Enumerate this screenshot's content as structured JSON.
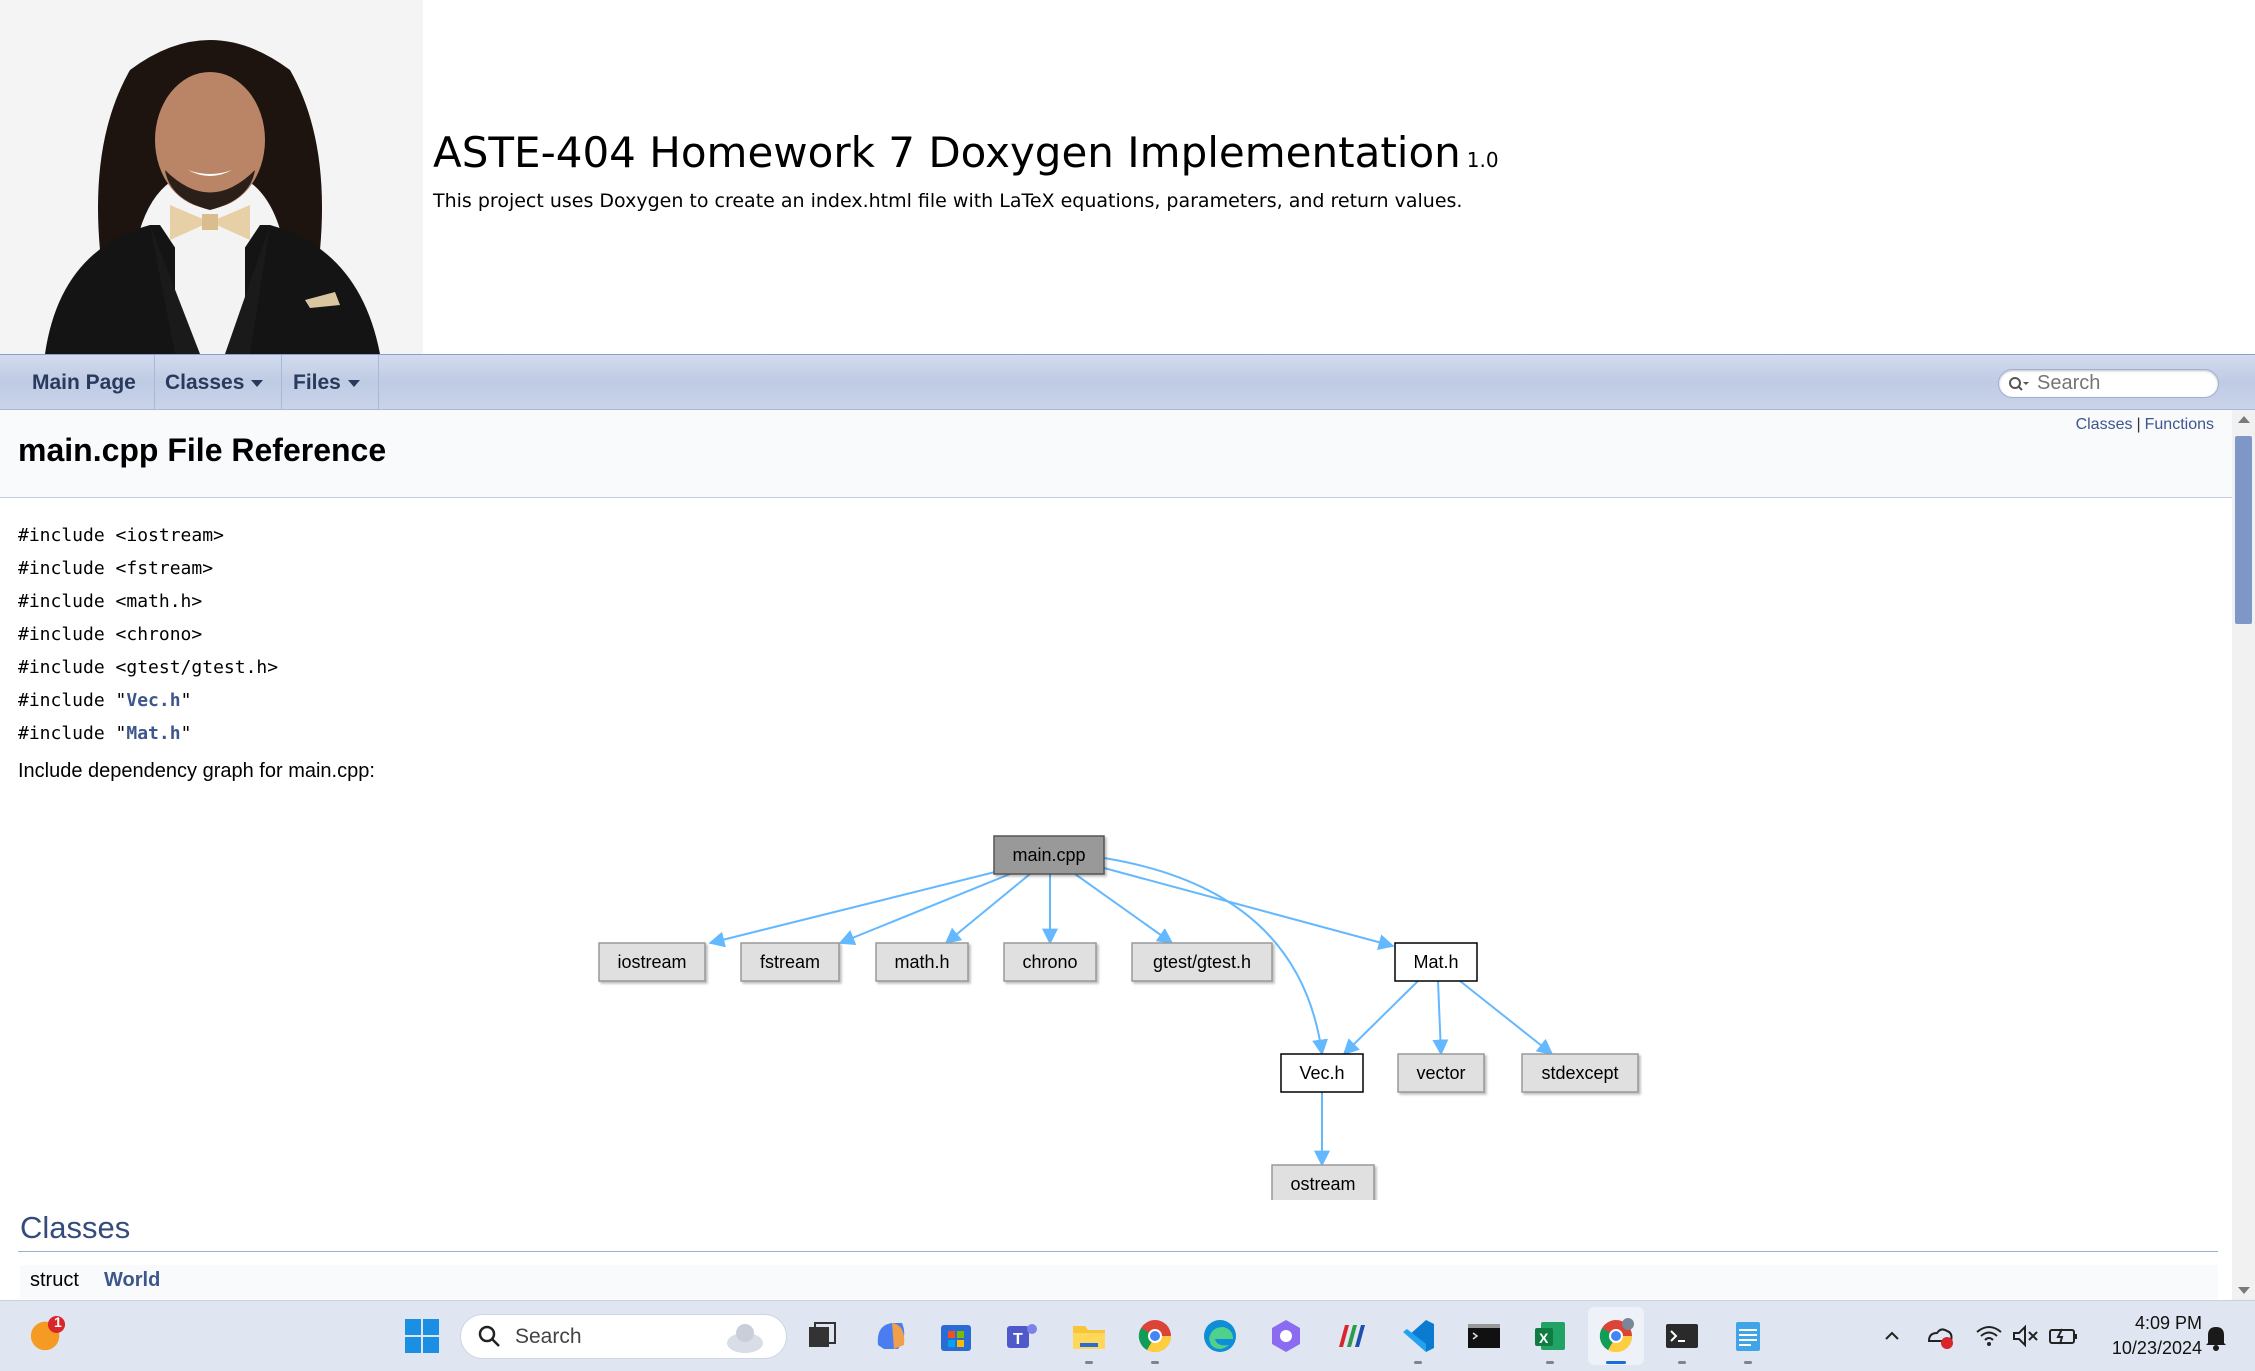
{
  "header": {
    "project_name": "ASTE-404 Homework 7 Doxygen Implementation",
    "project_number": "1.0",
    "project_brief": "This project uses Doxygen to create an index.html file with LaTeX equations, parameters, and return values."
  },
  "nav": {
    "main_page": "Main Page",
    "classes": "Classes",
    "files": "Files",
    "search_placeholder": "Search"
  },
  "page": {
    "summary_classes": "Classes",
    "summary_separator": "|",
    "summary_functions": "Functions",
    "title": "main.cpp File Reference",
    "includes": [
      {
        "prefix": "#include <iostream>"
      },
      {
        "prefix": "#include <fstream>"
      },
      {
        "prefix": "#include <math.h>"
      },
      {
        "prefix": "#include <chrono>"
      },
      {
        "prefix": "#include <gtest/gtest.h>"
      },
      {
        "prefix": "#include \"",
        "link": "Vec.h",
        "suffix": "\""
      },
      {
        "prefix": "#include \"",
        "link": "Mat.h",
        "suffix": "\""
      }
    ],
    "graph_caption": "Include dependency graph for main.cpp:",
    "graph_nodes": [
      "main.cpp",
      "iostream",
      "fstream",
      "math.h",
      "chrono",
      "gtest/gtest.h",
      "Mat.h",
      "Vec.h",
      "vector",
      "stdexcept",
      "ostream"
    ],
    "classes_heading": "Classes",
    "class_kind": "struct",
    "class_name": "World"
  },
  "taskbar": {
    "notification_badge": "1",
    "search_label": "Search",
    "time": "4:09 PM",
    "date": "10/23/2024",
    "icons": [
      "mail-notification-icon",
      "start-icon",
      "task-view-icon",
      "copilot-icon",
      "store-icon",
      "teams-icon",
      "file-explorer-icon",
      "chrome-icon",
      "edge-icon",
      "copilot-app-icon",
      "matlab-icon",
      "vscode-icon",
      "terminal-icon",
      "excel-icon",
      "chrome-profile-icon",
      "terminal-alt-icon",
      "notepad-icon"
    ]
  },
  "colors": {
    "link": "#3d578c",
    "nav_text": "#283a5d",
    "edge": "#63b8ff",
    "node_root": "#999999",
    "node_ext": "#e0e0e0"
  }
}
